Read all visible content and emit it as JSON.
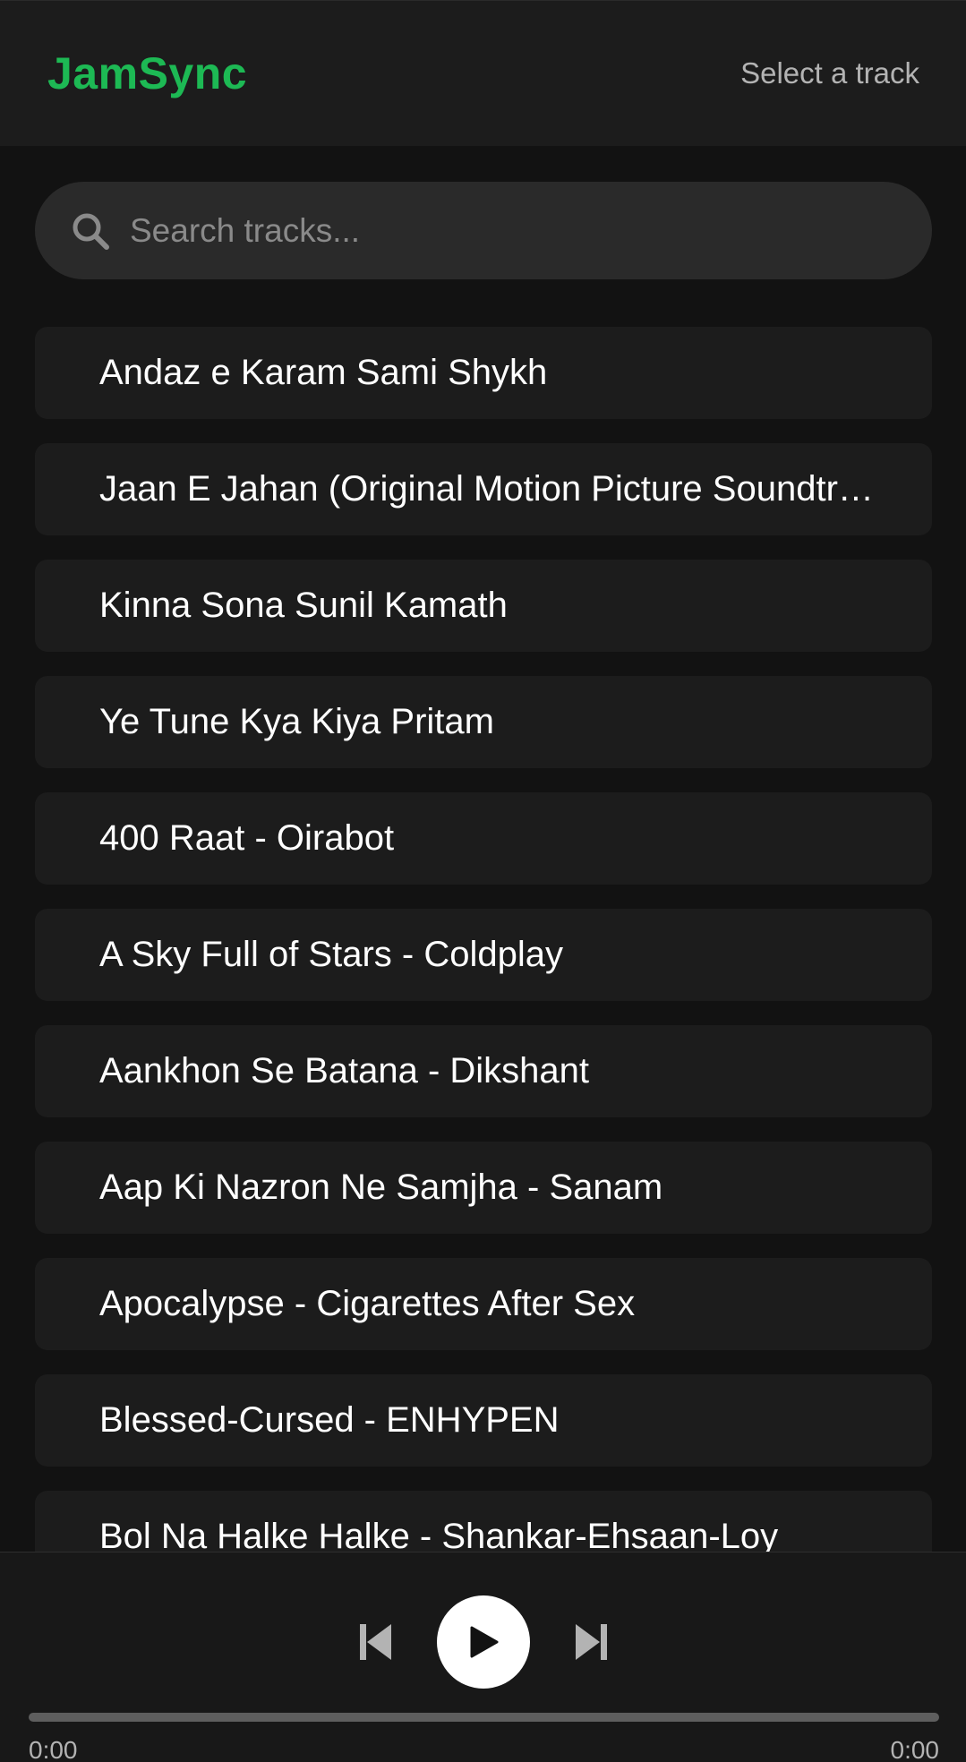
{
  "header": {
    "brand": "JamSync",
    "status": "Select a track"
  },
  "search": {
    "placeholder": "Search tracks...",
    "value": ""
  },
  "tracks": [
    "Andaz e Karam Sami Shykh",
    "Jaan E Jahan (Original Motion Picture Soundtrack)",
    "Kinna Sona Sunil Kamath",
    "Ye Tune Kya Kiya Pritam",
    "400 Raat - Oirabot",
    "A Sky Full of Stars - Coldplay",
    "Aankhon Se Batana - Dikshant",
    "Aap Ki Nazron Ne Samjha - Sanam",
    "Apocalypse - Cigarettes After Sex",
    "Blessed-Cursed - ENHYPEN",
    "Bol Na Halke Halke - Shankar-Ehsaan-Loy"
  ],
  "player": {
    "current_time": "0:00",
    "total_time": "0:00",
    "progress": 0,
    "icons": {
      "previous": "skip-previous-icon",
      "play": "play-icon",
      "next": "skip-next-icon"
    }
  },
  "colors": {
    "accent": "#1db954",
    "background": "#121212",
    "surface": "#1c1c1c",
    "search_bg": "#2a2a2a",
    "text_secondary": "#b3b3b3"
  }
}
